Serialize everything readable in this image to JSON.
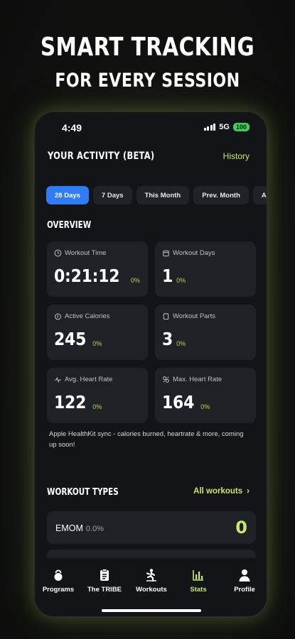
{
  "promo": {
    "line1": "SMART TRACKING",
    "line2": "FOR EVERY SESSION"
  },
  "status_bar": {
    "time": "4:49",
    "network": "5G",
    "battery": "100"
  },
  "header": {
    "title": "YOUR ACTIVITY (BETA)",
    "history_link": "History"
  },
  "range_chips": [
    {
      "label": "28 Days",
      "active": true
    },
    {
      "label": "7 Days",
      "active": false
    },
    {
      "label": "This Month",
      "active": false
    },
    {
      "label": "Prev. Month",
      "active": false
    },
    {
      "label": "All",
      "active": false
    }
  ],
  "overview": {
    "title": "OVERVIEW",
    "cards": [
      {
        "label": "Workout Time",
        "icon": "clock-icon",
        "value": "0:21:12",
        "change": "0%"
      },
      {
        "label": "Workout Days",
        "icon": "calendar-icon",
        "value": "1",
        "change": "0%"
      },
      {
        "label": "Active Calories",
        "icon": "flame-icon",
        "value": "245",
        "change": "0%"
      },
      {
        "label": "Workout Parts",
        "icon": "parts-icon",
        "value": "3",
        "change": "0%"
      },
      {
        "label": "Avg. Heart Rate",
        "icon": "pulse-icon",
        "value": "122",
        "change": "0%"
      },
      {
        "label": "Max. Heart Rate",
        "icon": "heart-rate-icon",
        "value": "164",
        "change": "0%"
      }
    ],
    "note": "Apple HealthKit sync - calories burned, heartrate & more, coming up soon!"
  },
  "workout_types": {
    "title": "WORKOUT TYPES",
    "all_link": "All workouts",
    "rows": [
      {
        "name": "EMOM",
        "percent": "0.0%",
        "count": "0"
      }
    ]
  },
  "tab_bar": {
    "items": [
      {
        "label": "Programs",
        "icon": "kettlebell-icon",
        "active": false
      },
      {
        "label": "The TRIBE",
        "icon": "board-icon",
        "active": false
      },
      {
        "label": "Workouts",
        "icon": "workout-figure-icon",
        "active": false
      },
      {
        "label": "Stats",
        "icon": "bar-chart-icon",
        "active": true
      },
      {
        "label": "Profile",
        "icon": "person-icon",
        "active": false
      }
    ]
  },
  "colors": {
    "accent": "#c8e86a",
    "active_chip": "#2f7cf6",
    "card_bg": "#1e2125",
    "screen_bg": "#121418"
  }
}
